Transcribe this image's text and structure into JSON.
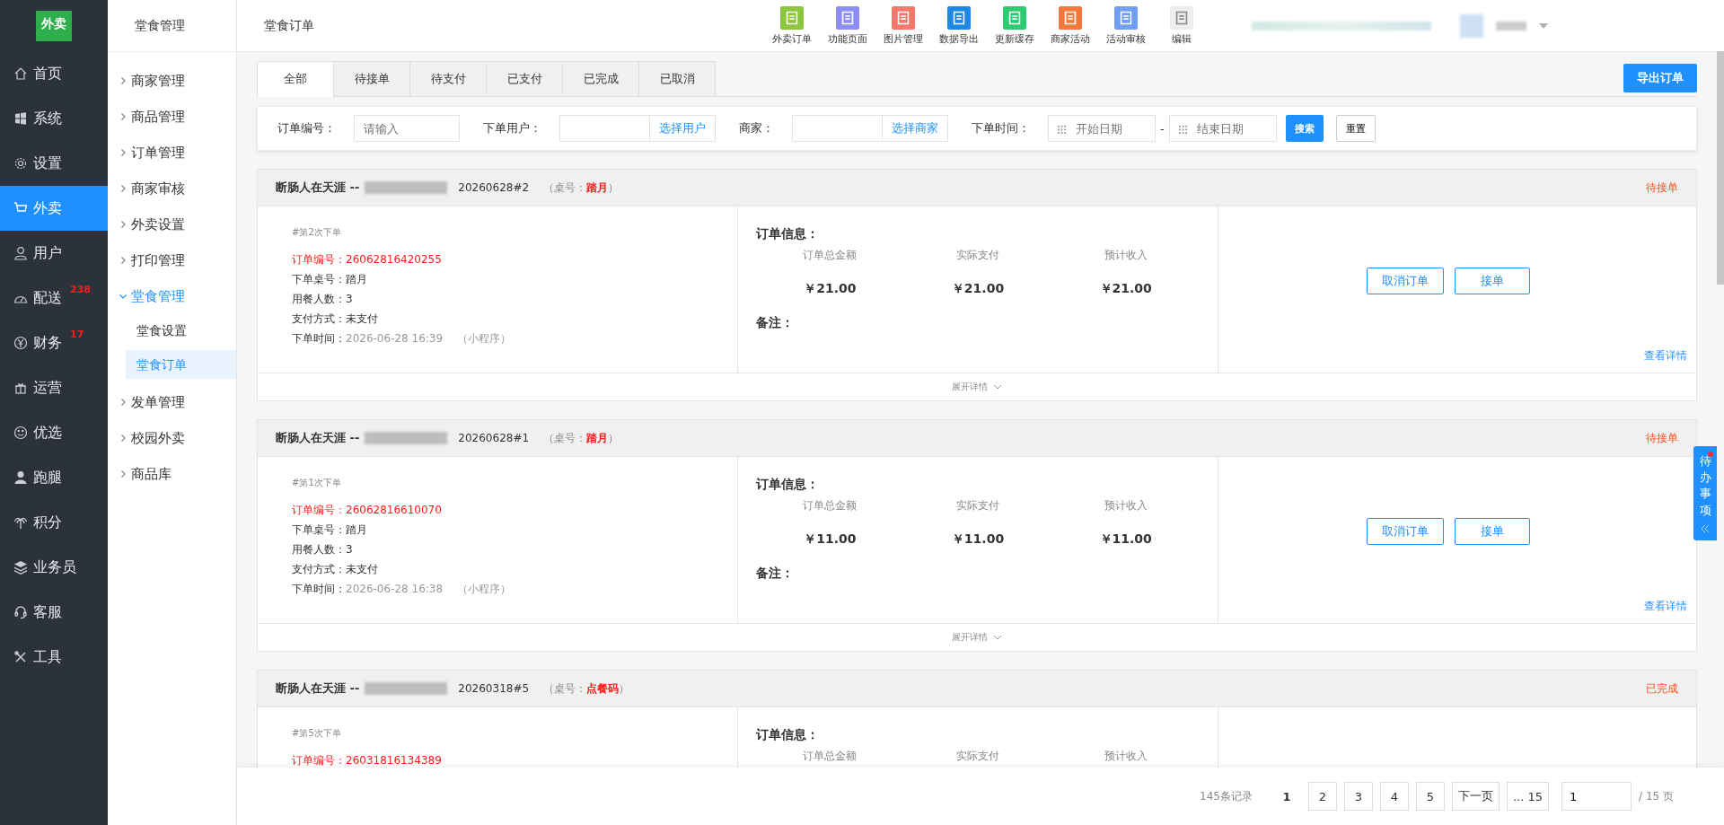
{
  "logo": {
    "text": "外卖"
  },
  "nav": [
    {
      "label": "首页",
      "selected": false
    },
    {
      "label": "系统",
      "selected": false
    },
    {
      "label": "设置",
      "selected": false
    },
    {
      "label": "外卖",
      "selected": true
    },
    {
      "label": "用户",
      "selected": false
    },
    {
      "label": "配送",
      "selected": false,
      "badge": "238"
    },
    {
      "label": "财务",
      "selected": false,
      "badge": "17"
    },
    {
      "label": "运营",
      "selected": false
    },
    {
      "label": "优选",
      "selected": false
    },
    {
      "label": "跑腿",
      "selected": false
    },
    {
      "label": "积分",
      "selected": false
    },
    {
      "label": "业务员",
      "selected": false
    },
    {
      "label": "客服",
      "selected": false
    },
    {
      "label": "工具",
      "selected": false
    }
  ],
  "submenu_title": "堂食管理",
  "submenu": [
    {
      "label": "商家管理",
      "expanded": false
    },
    {
      "label": "商品管理",
      "expanded": false
    },
    {
      "label": "订单管理",
      "expanded": false
    },
    {
      "label": "商家审核",
      "expanded": false
    },
    {
      "label": "外卖设置",
      "expanded": false
    },
    {
      "label": "打印管理",
      "expanded": false
    },
    {
      "label": "堂食管理",
      "expanded": true,
      "children": [
        {
          "label": "堂食设置",
          "selected": false
        },
        {
          "label": "堂食订单",
          "selected": true
        }
      ]
    },
    {
      "label": "发单管理",
      "expanded": false
    },
    {
      "label": "校园外卖",
      "expanded": false
    },
    {
      "label": "商品库",
      "expanded": false
    }
  ],
  "page_title": "堂食订单",
  "toolbar": [
    {
      "label": "外卖订单",
      "color": "#8cc63f"
    },
    {
      "label": "功能页面",
      "color": "#8b8ef5"
    },
    {
      "label": "图片管理",
      "color": "#f2786d"
    },
    {
      "label": "数据导出",
      "color": "#1e88e5"
    },
    {
      "label": "更新缓存",
      "color": "#2ecc71"
    },
    {
      "label": "商家活动",
      "color": "#f5793b"
    },
    {
      "label": "活动审核",
      "color": "#6f9ff5"
    },
    {
      "label": "编辑",
      "color": "#eeeeee"
    }
  ],
  "tabs": [
    {
      "label": "全部",
      "selected": true
    },
    {
      "label": "待接单",
      "selected": false
    },
    {
      "label": "待支付",
      "selected": false
    },
    {
      "label": "已支付",
      "selected": false
    },
    {
      "label": "已完成",
      "selected": false
    },
    {
      "label": "已取消",
      "selected": false
    }
  ],
  "export_button": "导出订单",
  "filters": {
    "order_no_label": "订单编号：",
    "order_no_placeholder": "请输入",
    "user_label": "下单用户：",
    "user_button": "选择用户",
    "merchant_label": "商家：",
    "merchant_button": "选择商家",
    "time_label": "下单时间：",
    "start_placeholder": "开始日期",
    "dash": "-",
    "end_placeholder": "结束日期",
    "search": "搜索",
    "reset": "重置"
  },
  "orders": [
    {
      "customer": "断肠人在天涯 --",
      "serial": "20260628#2",
      "table_prefix": "（桌号：",
      "table": "踏月",
      "table_suffix": "）",
      "status": "待接单",
      "count": "#第2次下单",
      "fields": [
        {
          "label": "订单编号：",
          "value": "26062816420255",
          "kind": "highlight"
        },
        {
          "label": "下单桌号：",
          "value": "踏月",
          "kind": "normal"
        },
        {
          "label": "用餐人数：",
          "value": "3",
          "kind": "normal"
        },
        {
          "label": "支付方式：",
          "value": "未支付",
          "kind": "normal"
        },
        {
          "label": "下单时间：",
          "value": "2026-06-28 16:39",
          "kind": "muted",
          "note": "（小程序）"
        }
      ],
      "info_title": "订单信息：",
      "amounts": [
        {
          "label": "订单总金额",
          "value": "￥21.00"
        },
        {
          "label": "实际支付",
          "value": "￥21.00"
        },
        {
          "label": "预计收入",
          "value": "￥21.00"
        }
      ],
      "remark": "备注：",
      "actions": [
        "取消订单",
        "接单"
      ],
      "detail_link": "查看详情",
      "expand": "展开详情"
    },
    {
      "customer": "断肠人在天涯 --",
      "serial": "20260628#1",
      "table_prefix": "（桌号：",
      "table": "踏月",
      "table_suffix": "）",
      "status": "待接单",
      "count": "#第1次下单",
      "fields": [
        {
          "label": "订单编号：",
          "value": "26062816610070",
          "kind": "highlight"
        },
        {
          "label": "下单桌号：",
          "value": "踏月",
          "kind": "normal"
        },
        {
          "label": "用餐人数：",
          "value": "3",
          "kind": "normal"
        },
        {
          "label": "支付方式：",
          "value": "未支付",
          "kind": "normal"
        },
        {
          "label": "下单时间：",
          "value": "2026-06-28 16:38",
          "kind": "muted",
          "note": "（小程序）"
        }
      ],
      "info_title": "订单信息：",
      "amounts": [
        {
          "label": "订单总金额",
          "value": "￥11.00"
        },
        {
          "label": "实际支付",
          "value": "￥11.00"
        },
        {
          "label": "预计收入",
          "value": "￥11.00"
        }
      ],
      "remark": "备注：",
      "actions": [
        "取消订单",
        "接单"
      ],
      "detail_link": "查看详情",
      "expand": "展开详情"
    },
    {
      "customer": "断肠人在天涯 --",
      "serial": "20260318#5",
      "table_prefix": "（桌号：",
      "table": "点餐码",
      "table_suffix": "）",
      "status": "已完成",
      "count": "#第5次下单",
      "fields": [
        {
          "label": "订单编号：",
          "value": "26031816134389",
          "kind": "highlight"
        }
      ],
      "info_title": "订单信息：",
      "amounts": [
        {
          "label": "订单总金额"
        },
        {
          "label": "实际支付"
        },
        {
          "label": "预计收入"
        }
      ]
    }
  ],
  "pagination": {
    "total": "145条记录",
    "pages": [
      {
        "label": "1",
        "selected": true
      },
      {
        "label": "2",
        "selected": false
      },
      {
        "label": "3",
        "selected": false
      },
      {
        "label": "4",
        "selected": false
      },
      {
        "label": "5",
        "selected": false
      }
    ],
    "next": "下一页",
    "last": "... 15",
    "jump_value": "1",
    "page_count": "/ 15 页"
  },
  "todo": {
    "label": "待办事项"
  }
}
